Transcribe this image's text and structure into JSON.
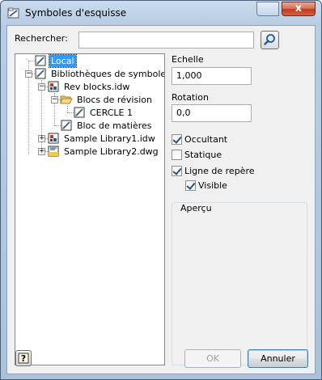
{
  "window": {
    "title": "Symboles d'esquisse",
    "close_glyph": "x"
  },
  "search": {
    "label": "Rechercher:",
    "value": "",
    "button_icon": "magnifier-icon"
  },
  "tree": {
    "items": [
      {
        "label": "Local",
        "icon": "sketch-symbol-icon",
        "selected": true
      },
      {
        "label": "Bibliothèques de symboles",
        "icon": "sketch-symbol-icon",
        "expander": "−"
      },
      {
        "label": "Rev blocks.idw",
        "icon": "drawing-file-icon",
        "expander": "−"
      },
      {
        "label": "Blocs de révision",
        "icon": "folder-open-icon",
        "expander": "−"
      },
      {
        "label": "CERCLE 1",
        "icon": "sketch-symbol-icon"
      },
      {
        "label": "Bloc de matières",
        "icon": "sketch-symbol-icon"
      },
      {
        "label": "Sample Library1.idw",
        "icon": "drawing-file-icon",
        "expander": "+"
      },
      {
        "label": "Sample Library2.dwg",
        "icon": "dwg-file-icon",
        "expander": "+"
      }
    ]
  },
  "scale": {
    "label": "Echelle",
    "value": "1,000"
  },
  "rotation": {
    "label": "Rotation",
    "value": "0,0"
  },
  "options": {
    "occultant": {
      "label": "Occultant",
      "checked": true
    },
    "statique": {
      "label": "Statique",
      "checked": false
    },
    "leader": {
      "label": "Ligne de repère",
      "checked": true
    },
    "visible": {
      "label": "Visible",
      "checked": true
    }
  },
  "preview": {
    "label": "Aperçu"
  },
  "buttons": {
    "help_glyph": "?",
    "ok": "OK",
    "cancel": "Annuler"
  }
}
